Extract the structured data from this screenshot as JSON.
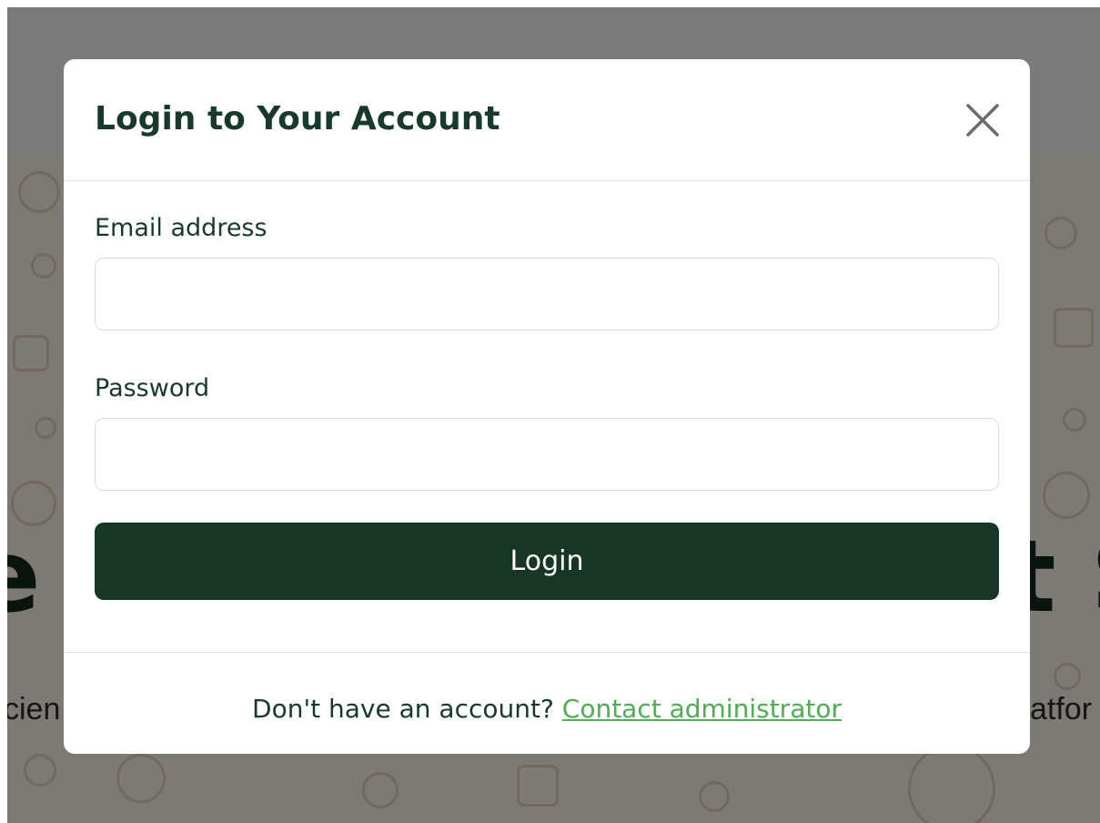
{
  "background": {
    "hero_partial_left": "e",
    "hero_partial_right": "t S",
    "sub_partial_left": "cien",
    "sub_partial_right": "atfor"
  },
  "modal": {
    "title": "Login to Your Account",
    "close_icon": "close-icon",
    "email": {
      "label": "Email address",
      "value": "",
      "placeholder": ""
    },
    "password": {
      "label": "Password",
      "value": "",
      "placeholder": ""
    },
    "login_button_label": "Login",
    "footer_text": "Don't have an account?",
    "footer_link_label": "Contact administrator"
  },
  "colors": {
    "brand_dark_green": "#173626",
    "link_green": "#4caf50",
    "overlay": "#808080"
  }
}
